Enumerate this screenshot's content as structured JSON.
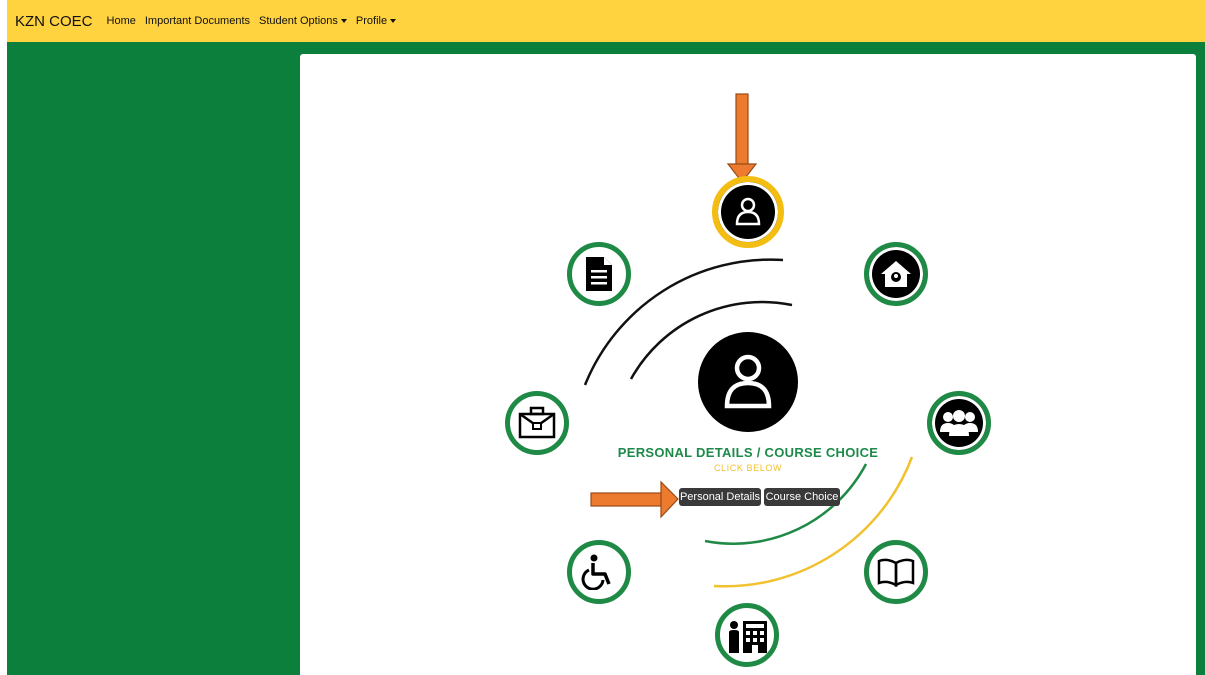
{
  "navbar": {
    "brand": "KZN COEC",
    "items": [
      {
        "label": "Home",
        "dropdown": false
      },
      {
        "label": "Important Documents",
        "dropdown": false
      },
      {
        "label": "Student Options",
        "dropdown": true
      },
      {
        "label": "Profile",
        "dropdown": true
      }
    ]
  },
  "main": {
    "section_title": "PERSONAL DETAILS / COURSE CHOICE",
    "section_subtitle": "CLICK BELOW",
    "buttons": {
      "personal_details": "Personal Details",
      "course_choice": "Course Choice"
    },
    "wheel_icons": [
      {
        "name": "user-icon",
        "active": true
      },
      {
        "name": "home-location-icon",
        "active": false
      },
      {
        "name": "group-icon",
        "active": false
      },
      {
        "name": "book-icon",
        "active": false
      },
      {
        "name": "college-icon",
        "active": false
      },
      {
        "name": "wheelchair-icon",
        "active": false
      },
      {
        "name": "briefcase-icon",
        "active": false
      },
      {
        "name": "document-icon",
        "active": false
      }
    ]
  },
  "colors": {
    "navbar": "#ffd23f",
    "background": "#0c7f3c",
    "ring": "#1f8a45",
    "active_ring": "#f4bd12",
    "arrow": "#ec7a2f",
    "title": "#1d8a4a",
    "subtitle": "#f2c12e"
  }
}
